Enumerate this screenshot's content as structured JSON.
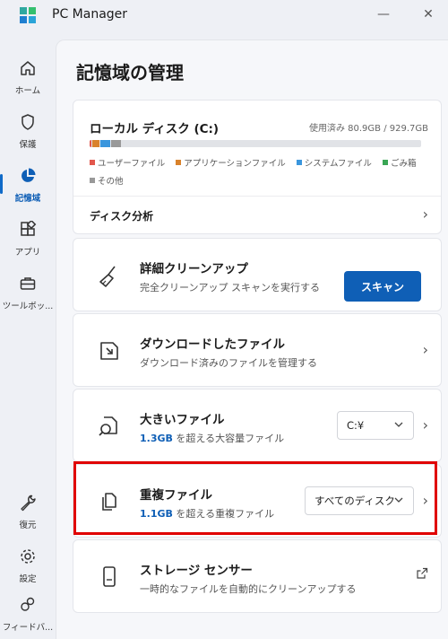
{
  "app": {
    "title": "PC Manager",
    "minimize_glyph": "—",
    "close_glyph": "✕"
  },
  "nav": {
    "items": [
      {
        "label": "ホーム",
        "icon": "home-icon"
      },
      {
        "label": "保護",
        "icon": "shield-icon"
      },
      {
        "label": "記憶域",
        "icon": "pie-chart-icon",
        "active": true
      },
      {
        "label": "アプリ",
        "icon": "apps-icon"
      },
      {
        "label": "ツールボッ...",
        "icon": "toolbox-icon"
      },
      {
        "label": "復元",
        "icon": "wrench-icon"
      },
      {
        "label": "設定",
        "icon": "gear-icon"
      },
      {
        "label": "フィードバ...",
        "icon": "feedback-icon"
      }
    ]
  },
  "page": {
    "title": "記憶域の管理"
  },
  "disk": {
    "name": "ローカル ディスク (C:)",
    "usage": "使用済み 80.9GB / 929.7GB",
    "legend": [
      "ユーザーファイル",
      "アプリケーションファイル",
      "システムファイル",
      "ごみ箱",
      "その他"
    ],
    "colors": {
      "user": "#e2574c",
      "apps": "#d9822b",
      "system": "#3a96dd",
      "recycle": "#3aa655",
      "other": "#999999",
      "track": "#e1e3e7"
    },
    "segments": [
      {
        "key": "user",
        "fraction": 0.006
      },
      {
        "key": "apps",
        "fraction": 0.02
      },
      {
        "key": "system",
        "fraction": 0.03
      },
      {
        "key": "other",
        "fraction": 0.03
      }
    ],
    "analysis_label": "ディスク分析"
  },
  "cleanup": {
    "title": "詳細クリーンアップ",
    "subtitle": "完全クリーンアップ スキャンを実行する",
    "button": "スキャン"
  },
  "downloads": {
    "title": "ダウンロードしたファイル",
    "subtitle": "ダウンロード済みのファイルを管理する"
  },
  "large": {
    "title": "大きいファイル",
    "size": "1.3GB",
    "subtitle_rest": " を超える大容量ファイル",
    "drive": "C:¥"
  },
  "duplicates": {
    "title": "重複ファイル",
    "size": "1.1GB",
    "subtitle_rest": " を超える重複ファイル",
    "scope": "すべてのディスク"
  },
  "sensor": {
    "title": "ストレージ センサー",
    "subtitle": "一時的なファイルを自動的にクリーンアップする"
  },
  "theme": {
    "accent": "#0f5fb6",
    "highlight_border": "#e00000"
  }
}
